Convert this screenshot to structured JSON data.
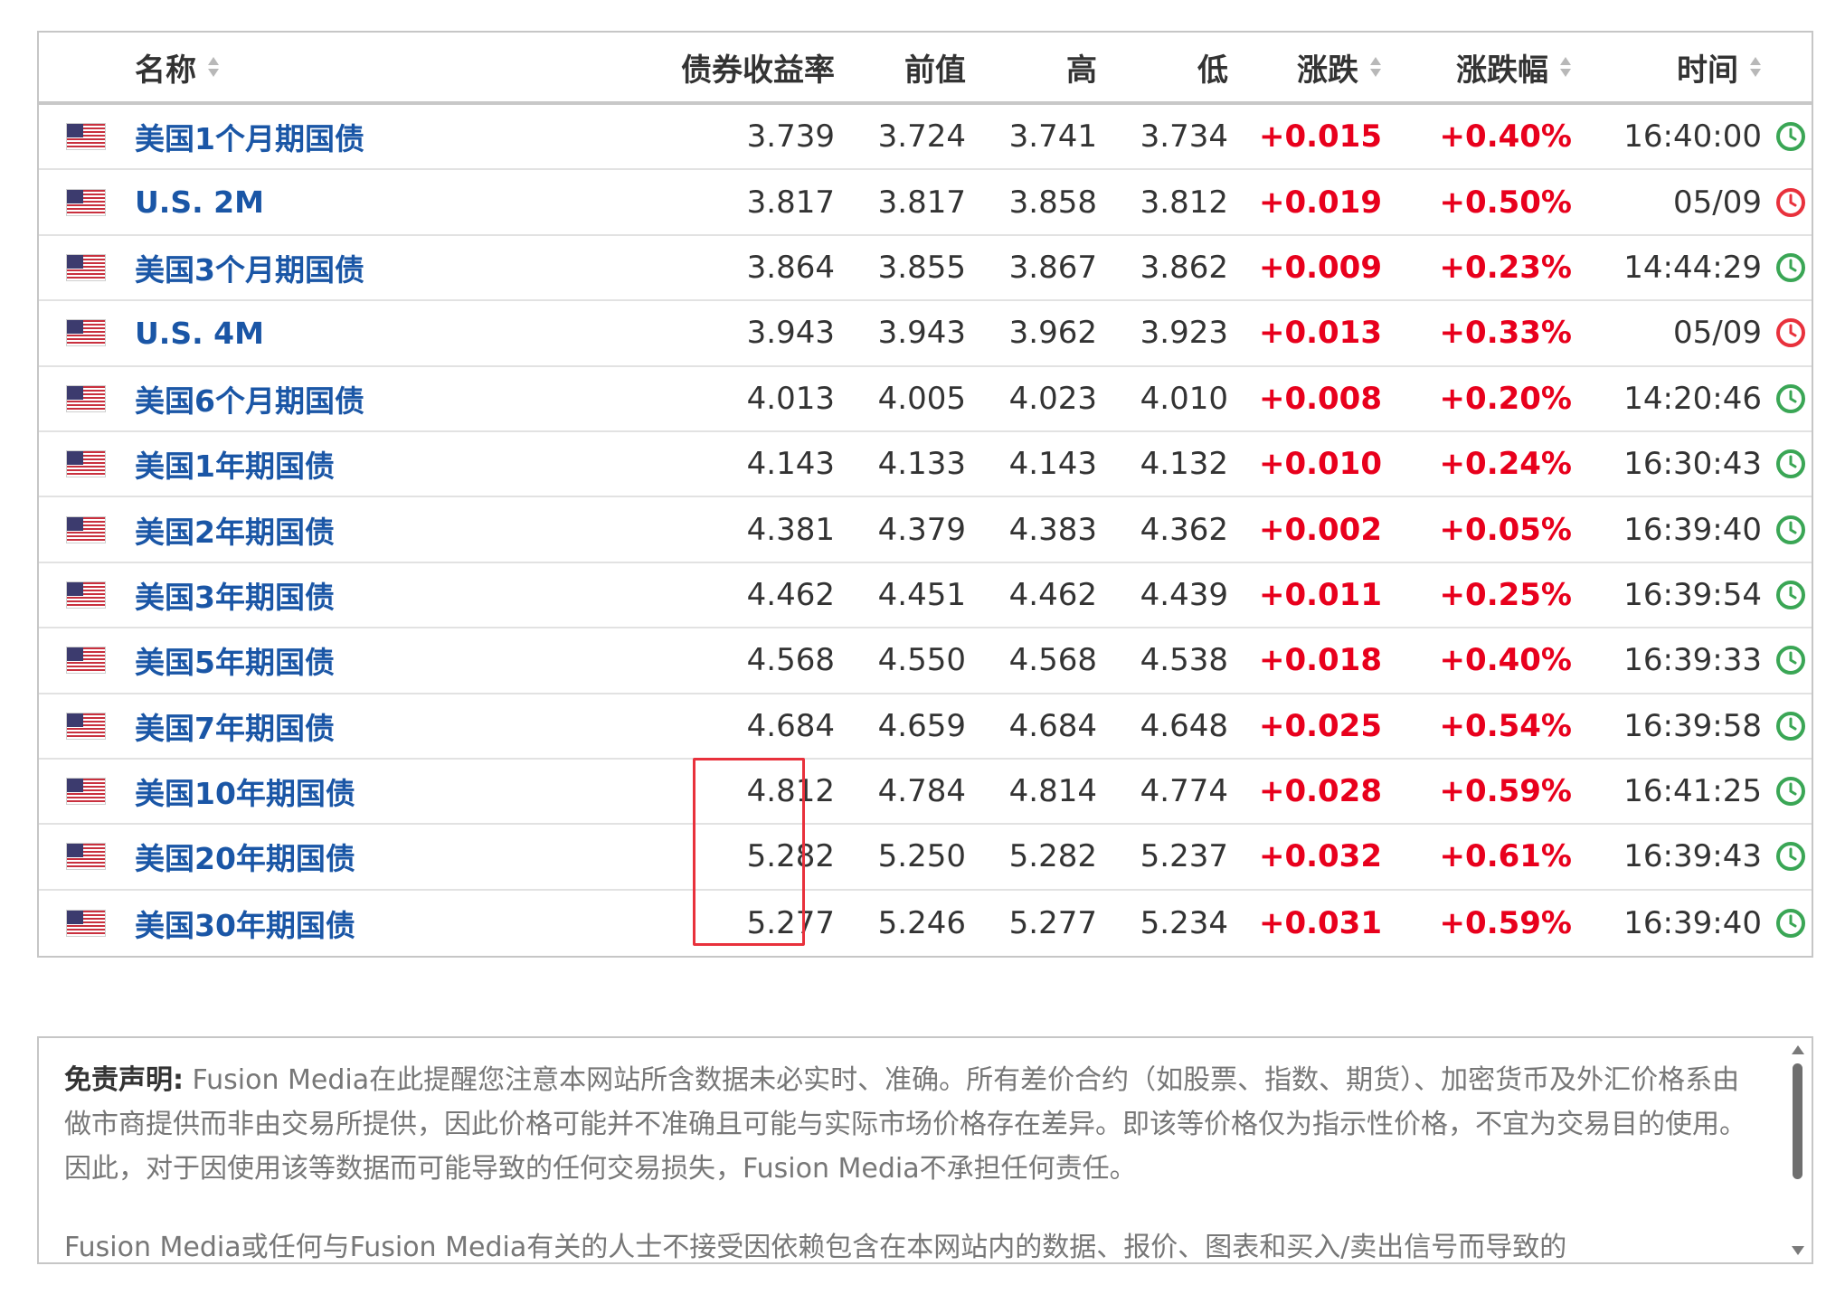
{
  "table": {
    "columns": {
      "name": "名称",
      "yield": "债券收益率",
      "prev": "前值",
      "high": "高",
      "low": "低",
      "change": "涨跌",
      "change_pct": "涨跌幅",
      "time": "时间"
    },
    "rows": [
      {
        "name": "美国1个月期国债",
        "yield": "3.739",
        "prev": "3.724",
        "high": "3.741",
        "low": "3.734",
        "change": "+0.015",
        "change_pct": "+0.40%",
        "time": "16:40:00",
        "clock": "green-clock-icon"
      },
      {
        "name": "U.S. 2M",
        "yield": "3.817",
        "prev": "3.817",
        "high": "3.858",
        "low": "3.812",
        "change": "+0.019",
        "change_pct": "+0.50%",
        "time": "05/09",
        "clock": "red-clock-icon"
      },
      {
        "name": "美国3个月期国债",
        "yield": "3.864",
        "prev": "3.855",
        "high": "3.867",
        "low": "3.862",
        "change": "+0.009",
        "change_pct": "+0.23%",
        "time": "14:44:29",
        "clock": "green-clock-icon"
      },
      {
        "name": "U.S. 4M",
        "yield": "3.943",
        "prev": "3.943",
        "high": "3.962",
        "low": "3.923",
        "change": "+0.013",
        "change_pct": "+0.33%",
        "time": "05/09",
        "clock": "red-clock-icon"
      },
      {
        "name": "美国6个月期国债",
        "yield": "4.013",
        "prev": "4.005",
        "high": "4.023",
        "low": "4.010",
        "change": "+0.008",
        "change_pct": "+0.20%",
        "time": "14:20:46",
        "clock": "green-clock-icon"
      },
      {
        "name": "美国1年期国债",
        "yield": "4.143",
        "prev": "4.133",
        "high": "4.143",
        "low": "4.132",
        "change": "+0.010",
        "change_pct": "+0.24%",
        "time": "16:30:43",
        "clock": "green-clock-icon"
      },
      {
        "name": "美国2年期国债",
        "yield": "4.381",
        "prev": "4.379",
        "high": "4.383",
        "low": "4.362",
        "change": "+0.002",
        "change_pct": "+0.05%",
        "time": "16:39:40",
        "clock": "green-clock-icon"
      },
      {
        "name": "美国3年期国债",
        "yield": "4.462",
        "prev": "4.451",
        "high": "4.462",
        "low": "4.439",
        "change": "+0.011",
        "change_pct": "+0.25%",
        "time": "16:39:54",
        "clock": "green-clock-icon"
      },
      {
        "name": "美国5年期国债",
        "yield": "4.568",
        "prev": "4.550",
        "high": "4.568",
        "low": "4.538",
        "change": "+0.018",
        "change_pct": "+0.40%",
        "time": "16:39:33",
        "clock": "green-clock-icon"
      },
      {
        "name": "美国7年期国债",
        "yield": "4.684",
        "prev": "4.659",
        "high": "4.684",
        "low": "4.648",
        "change": "+0.025",
        "change_pct": "+0.54%",
        "time": "16:39:58",
        "clock": "green-clock-icon"
      },
      {
        "name": "美国10年期国债",
        "yield": "4.812",
        "prev": "4.784",
        "high": "4.814",
        "low": "4.774",
        "change": "+0.028",
        "change_pct": "+0.59%",
        "time": "16:41:25",
        "clock": "green-clock-icon"
      },
      {
        "name": "美国20年期国债",
        "yield": "5.282",
        "prev": "5.250",
        "high": "5.282",
        "low": "5.237",
        "change": "+0.032",
        "change_pct": "+0.61%",
        "time": "16:39:43",
        "clock": "green-clock-icon"
      },
      {
        "name": "美国30年期国债",
        "yield": "5.277",
        "prev": "5.246",
        "high": "5.277",
        "low": "5.234",
        "change": "+0.031",
        "change_pct": "+0.59%",
        "time": "16:39:40",
        "clock": "green-clock-icon"
      }
    ],
    "flag_icon": "us-flag-icon"
  },
  "disclaimer": {
    "heading": "免责声明:",
    "para1": "Fusion Media在此提醒您注意本网站所含数据未必实时、准确。所有差价合约（如股票、指数、期货）、加密货币及外汇价格系由做市商提供而非由交易所提供，因此价格可能并不准确且可能与实际市场价格存在差异。即该等价格仅为指示性价格，不宜为交易目的使用。因此，对于因使用该等数据而可能导致的任何交易损失，Fusion Media不承担任何责任。",
    "para2": "Fusion Media或任何与Fusion Media有关的人士不接受因依赖包含在本网站内的数据、报价、图表和买入/卖出信号而导致的"
  },
  "colors": {
    "link_blue": "#1a56a6",
    "positive_red": "#e8001c",
    "clock_green": "#3aa655",
    "clock_red": "#e8313c",
    "highlight_red": "#e8313c"
  }
}
